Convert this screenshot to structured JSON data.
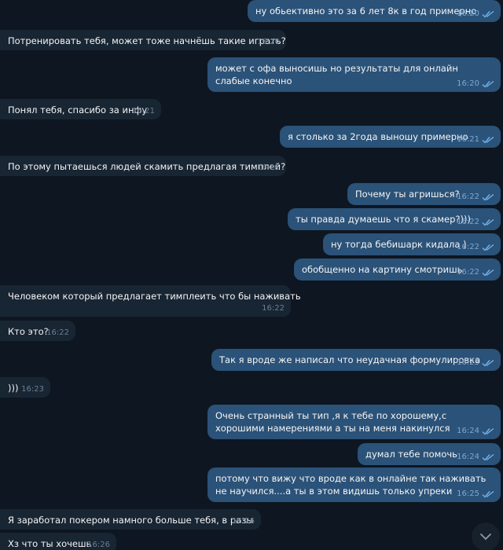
{
  "messages": [
    {
      "dir": "out",
      "text": "ну обьективно это за 6 лет 8к в год примерно",
      "time": "16:20"
    },
    {
      "dir": "in",
      "text": "Потренировать тебя, может тоже начнёшь такие играть?",
      "time": "16:20"
    },
    {
      "dir": "out",
      "text": "может с офа выносишь но результаты для онлайн слабые конечно",
      "time": "16:20"
    },
    {
      "dir": "in",
      "text": "Понял тебя, спасибо за инфу",
      "time": "16:21"
    },
    {
      "dir": "out",
      "text": "я столько за 2года выношу примерно",
      "time": "16:21"
    },
    {
      "dir": "in",
      "text": "По этому пытаешься людей скамить предлагая тимплей?",
      "time": "16:21"
    },
    {
      "dir": "out",
      "text": "Почему ты агришься?",
      "time": "16:22"
    },
    {
      "dir": "out",
      "text": "ты правда думаешь что я скамер?)))",
      "time": "16:22"
    },
    {
      "dir": "out",
      "text": "ну тогда бебишарк кидала )",
      "time": "16:22"
    },
    {
      "dir": "out",
      "text": "обобщенно на картину смотришь",
      "time": "16:22"
    },
    {
      "dir": "in",
      "text": "Человеком который предлагает тимплеить что бы наживать",
      "time": "16:22"
    },
    {
      "dir": "in",
      "text": "Кто это?",
      "time": "16:22"
    },
    {
      "dir": "out",
      "text": "Так я вроде же написал что неудачная формулировка",
      "time": "16:23"
    },
    {
      "dir": "in",
      "text": ")))",
      "time": "16:23"
    },
    {
      "dir": "out",
      "text": "Очень странный ты тип ,я к тебе по хорошему,с хорошими намерениями а ты на меня накинулся",
      "time": "16:24"
    },
    {
      "dir": "out",
      "text": "думал тебе помочь",
      "time": "16:24"
    },
    {
      "dir": "out",
      "text": "потому что вижу что вроде как в онлайне так наживать не научился....а ты в этом видишь только упреки",
      "time": "16:25"
    },
    {
      "dir": "in",
      "text": "Я заработал покером намного больше тебя, в разы",
      "time": "16:26"
    },
    {
      "dir": "in",
      "text": "Хз что ты хочешь",
      "time": "16:26"
    }
  ],
  "icons": {
    "read_receipt": "double-check-icon",
    "scroll_down": "chevron-down-icon"
  },
  "colors": {
    "background": "#0e1621",
    "incoming_bubble": "#182533",
    "outgoing_bubble": "#2b5278",
    "tick": "#6fb3ee"
  }
}
